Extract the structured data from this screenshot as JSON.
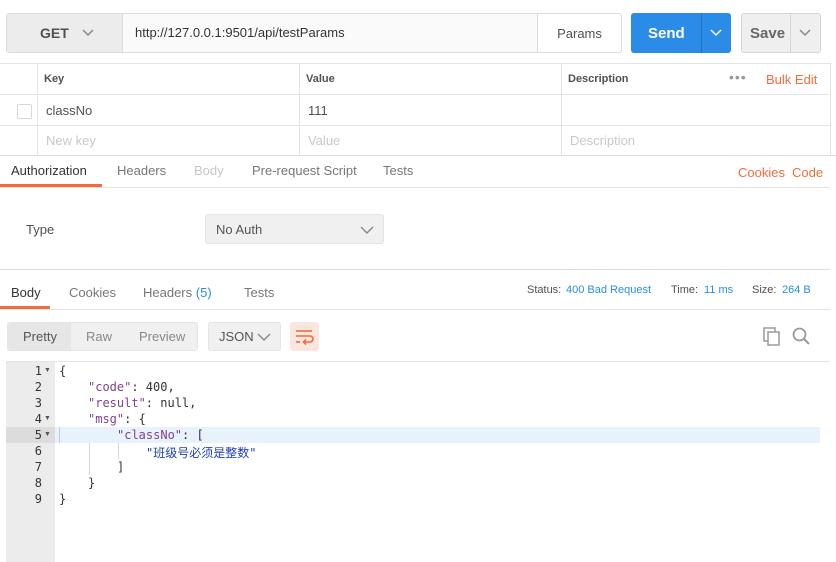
{
  "request": {
    "method": "GET",
    "url": "http://127.0.0.1:9501/api/testParams",
    "params_label": "Params",
    "send_label": "Send",
    "save_label": "Save"
  },
  "params_table": {
    "headers": {
      "key": "Key",
      "value": "Value",
      "description": "Description"
    },
    "more": "•••",
    "bulk_edit": "Bulk Edit",
    "rows": [
      {
        "key": "classNo",
        "value": "111",
        "description": ""
      }
    ],
    "placeholders": {
      "key": "New key",
      "value": "Value",
      "description": "Description"
    }
  },
  "request_tabs": [
    "Authorization",
    "Headers",
    "Body",
    "Pre-request Script",
    "Tests"
  ],
  "request_links": {
    "cookies": "Cookies",
    "code": "Code"
  },
  "auth": {
    "type_label": "Type",
    "selected": "No Auth"
  },
  "response_tabs": {
    "body": "Body",
    "cookies": "Cookies",
    "headers": "Headers",
    "headers_count": "(5)",
    "tests": "Tests"
  },
  "response_meta": {
    "status_label": "Status:",
    "status_value": "400 Bad Request",
    "time_label": "Time:",
    "time_value": "11 ms",
    "size_label": "Size:",
    "size_value": "264 B"
  },
  "view_modes": [
    "Pretty",
    "Raw",
    "Preview"
  ],
  "language": "JSON",
  "code_lines": {
    "line_numbers": [
      "1",
      "2",
      "3",
      "4",
      "5",
      "6",
      "7",
      "8",
      "9"
    ],
    "l1": "{",
    "l2_key": "\"code\"",
    "l2_rest": ": 400,",
    "l3_key": "\"result\"",
    "l3_rest": ": null,",
    "l4_key": "\"msg\"",
    "l4_rest": ": {",
    "l5_key": "\"classNo\"",
    "l5_rest": ": [",
    "l6_str": "\"班级号必须是整数\"",
    "l7": "]",
    "l8": "}",
    "l9": "}"
  },
  "colors": {
    "accent": "#f26b3a",
    "send": "#2a8ce6",
    "json_key": "#7d4393",
    "json_string": "#1d3fb6"
  }
}
